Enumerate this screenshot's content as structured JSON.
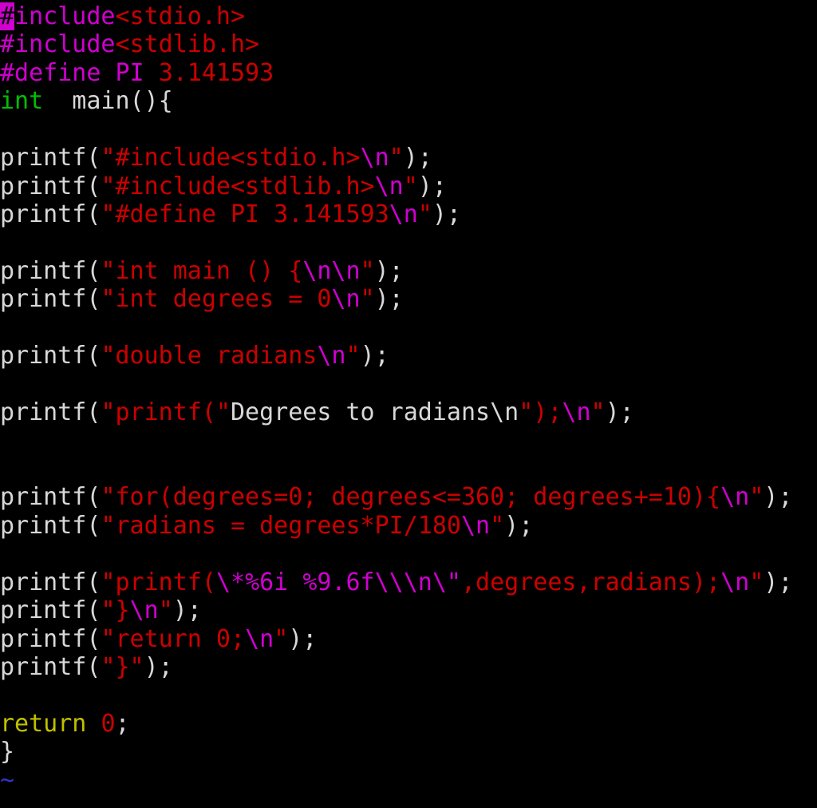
{
  "app": {
    "name": "vim",
    "mode": "normal",
    "background": "#000000",
    "foreground": "#d8d8d8"
  },
  "cursor": {
    "char": "#",
    "row": 1,
    "column": 1,
    "color": "#d000d0"
  },
  "colors": {
    "string": "#cc0000",
    "escape": "#d000d0",
    "preproc": "#d000d0",
    "type": "#00c000",
    "keyword": "#c0c000",
    "number": "#cc0000",
    "normal": "#d8d8d8",
    "nontext": "#3333cc",
    "background": "#000000"
  },
  "buffer": {
    "lines": [
      {
        "n": 1,
        "text": "#include<stdio.h>",
        "spans": [
          {
            "t": "#",
            "c": "cursor"
          },
          {
            "t": "include",
            "c": "preproc"
          },
          {
            "t": "<stdio.h>",
            "c": "string"
          }
        ]
      },
      {
        "n": 2,
        "text": "#include<stdlib.h>",
        "spans": [
          {
            "t": "#include",
            "c": "preproc"
          },
          {
            "t": "<stdlib.h>",
            "c": "string"
          }
        ]
      },
      {
        "n": 3,
        "text": "#define PI 3.141593",
        "spans": [
          {
            "t": "#define PI ",
            "c": "preproc"
          },
          {
            "t": "3.141593",
            "c": "number"
          }
        ]
      },
      {
        "n": 4,
        "text": "int  main(){",
        "spans": [
          {
            "t": "int",
            "c": "type"
          },
          {
            "t": "  main(){",
            "c": "white"
          }
        ]
      },
      {
        "n": 5,
        "text": "",
        "spans": []
      },
      {
        "n": 6,
        "text": "printf(\"#include<stdio.h>\\n\");",
        "spans": [
          {
            "t": "printf(",
            "c": "white"
          },
          {
            "t": "\"#include<stdio.h>",
            "c": "string"
          },
          {
            "t": "\\n",
            "c": "escape"
          },
          {
            "t": "\"",
            "c": "string"
          },
          {
            "t": ");",
            "c": "white"
          }
        ]
      },
      {
        "n": 7,
        "text": "printf(\"#include<stdlib.h>\\n\");",
        "spans": [
          {
            "t": "printf(",
            "c": "white"
          },
          {
            "t": "\"#include<stdlib.h>",
            "c": "string"
          },
          {
            "t": "\\n",
            "c": "escape"
          },
          {
            "t": "\"",
            "c": "string"
          },
          {
            "t": ");",
            "c": "white"
          }
        ]
      },
      {
        "n": 8,
        "text": "printf(\"#define PI 3.141593\\n\");",
        "spans": [
          {
            "t": "printf(",
            "c": "white"
          },
          {
            "t": "\"#define PI 3.141593",
            "c": "string"
          },
          {
            "t": "\\n",
            "c": "escape"
          },
          {
            "t": "\"",
            "c": "string"
          },
          {
            "t": ");",
            "c": "white"
          }
        ]
      },
      {
        "n": 9,
        "text": "",
        "spans": []
      },
      {
        "n": 10,
        "text": "printf(\"int main () {\\n\\n\");",
        "spans": [
          {
            "t": "printf(",
            "c": "white"
          },
          {
            "t": "\"int main () {",
            "c": "string"
          },
          {
            "t": "\\n\\n",
            "c": "escape"
          },
          {
            "t": "\"",
            "c": "string"
          },
          {
            "t": ");",
            "c": "white"
          }
        ]
      },
      {
        "n": 11,
        "text": "printf(\"int degrees = 0\\n\");",
        "spans": [
          {
            "t": "printf(",
            "c": "white"
          },
          {
            "t": "\"int degrees = 0",
            "c": "string"
          },
          {
            "t": "\\n",
            "c": "escape"
          },
          {
            "t": "\"",
            "c": "string"
          },
          {
            "t": ");",
            "c": "white"
          }
        ]
      },
      {
        "n": 12,
        "text": "",
        "spans": []
      },
      {
        "n": 13,
        "text": "printf(\"double radians\\n\");",
        "spans": [
          {
            "t": "printf(",
            "c": "white"
          },
          {
            "t": "\"double radians",
            "c": "string"
          },
          {
            "t": "\\n",
            "c": "escape"
          },
          {
            "t": "\"",
            "c": "string"
          },
          {
            "t": ");",
            "c": "white"
          }
        ]
      },
      {
        "n": 14,
        "text": "",
        "spans": []
      },
      {
        "n": 15,
        "text": "printf(\"printf(\"Degrees to radians\\n\");\\n\");",
        "spans": [
          {
            "t": "printf(",
            "c": "white"
          },
          {
            "t": "\"printf(\"",
            "c": "string"
          },
          {
            "t": "Degrees to radians\\n",
            "c": "white"
          },
          {
            "t": "\");",
            "c": "string"
          },
          {
            "t": "\\n",
            "c": "escape"
          },
          {
            "t": "\"",
            "c": "string"
          },
          {
            "t": ");",
            "c": "white"
          }
        ]
      },
      {
        "n": 16,
        "text": "",
        "spans": []
      },
      {
        "n": 17,
        "text": "",
        "spans": []
      },
      {
        "n": 18,
        "text": "printf(\"for(degrees=0; degrees<=360; degrees+=10){\\n\");",
        "spans": [
          {
            "t": "printf(",
            "c": "white"
          },
          {
            "t": "\"for(degrees=0; degrees<=360; degrees+=10){",
            "c": "string"
          },
          {
            "t": "\\n",
            "c": "escape"
          },
          {
            "t": "\"",
            "c": "string"
          },
          {
            "t": ");",
            "c": "white"
          }
        ]
      },
      {
        "n": 19,
        "text": "printf(\"radians = degrees*PI/180\\n\");",
        "spans": [
          {
            "t": "printf(",
            "c": "white"
          },
          {
            "t": "\"radians = degrees*PI/180",
            "c": "string"
          },
          {
            "t": "\\n",
            "c": "escape"
          },
          {
            "t": "\"",
            "c": "string"
          },
          {
            "t": ");",
            "c": "white"
          }
        ]
      },
      {
        "n": 20,
        "text": "",
        "spans": []
      },
      {
        "n": 21,
        "text": "printf(\"printf(\\*%6i %9.6f\\\\n\\\",degrees,radians);\\n\");",
        "spans": [
          {
            "t": "printf(",
            "c": "white"
          },
          {
            "t": "\"printf(",
            "c": "string"
          },
          {
            "t": "\\*",
            "c": "escape"
          },
          {
            "t": "%6i",
            "c": "escape"
          },
          {
            "t": " ",
            "c": "string"
          },
          {
            "t": "%9.6f",
            "c": "escape"
          },
          {
            "t": "\\\\",
            "c": "escape"
          },
          {
            "t": "\\n",
            "c": "escape"
          },
          {
            "t": "\\\"",
            "c": "escape"
          },
          {
            "t": ",degrees,radians);",
            "c": "string"
          },
          {
            "t": "\\n",
            "c": "escape"
          },
          {
            "t": "\"",
            "c": "string"
          },
          {
            "t": ");",
            "c": "white"
          }
        ]
      },
      {
        "n": 22,
        "text": "printf(\"}\\n\");",
        "spans": [
          {
            "t": "printf(",
            "c": "white"
          },
          {
            "t": "\"}",
            "c": "string"
          },
          {
            "t": "\\n",
            "c": "escape"
          },
          {
            "t": "\"",
            "c": "string"
          },
          {
            "t": ");",
            "c": "white"
          }
        ]
      },
      {
        "n": 23,
        "text": "printf(\"return 0;\\n\");",
        "spans": [
          {
            "t": "printf(",
            "c": "white"
          },
          {
            "t": "\"return 0;",
            "c": "string"
          },
          {
            "t": "\\n",
            "c": "escape"
          },
          {
            "t": "\"",
            "c": "string"
          },
          {
            "t": ");",
            "c": "white"
          }
        ]
      },
      {
        "n": 24,
        "text": "printf(\"}\");",
        "spans": [
          {
            "t": "printf(",
            "c": "white"
          },
          {
            "t": "\"}\"",
            "c": "string"
          },
          {
            "t": ");",
            "c": "white"
          }
        ]
      },
      {
        "n": 25,
        "text": "",
        "spans": []
      },
      {
        "n": 26,
        "text": "return 0;",
        "spans": [
          {
            "t": "return",
            "c": "keyword"
          },
          {
            "t": " ",
            "c": "white"
          },
          {
            "t": "0",
            "c": "number"
          },
          {
            "t": ";",
            "c": "white"
          }
        ]
      },
      {
        "n": 27,
        "text": "}",
        "spans": [
          {
            "t": "}",
            "c": "white"
          }
        ]
      },
      {
        "n": 28,
        "text": "~",
        "spans": [
          {
            "t": "~",
            "c": "tilde"
          }
        ]
      }
    ]
  }
}
